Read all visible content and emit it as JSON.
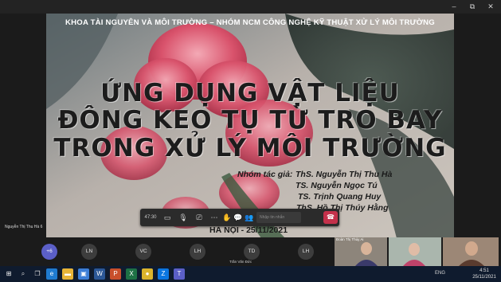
{
  "window": {
    "title": "",
    "controls": {
      "minimize": "–",
      "maximize": "⧉",
      "close": "✕"
    }
  },
  "slide": {
    "header": "KHOA TÀI NGUYÊN VÀ MÔI TRƯỜNG – NHÓM NCM CÔNG NGHỆ KỸ THUẬT XỬ LÝ MÔI TRƯỜNG",
    "title_lines": [
      "ỨNG DỤNG VẬT LIỆU",
      "ĐÔNG KEO TỤ TỪ TRO BAY",
      "TRONG XỬ LÝ MÔI TRƯỜNG"
    ],
    "authors_label": "Nhóm tác giả:",
    "authors": [
      "ThS. Nguyễn Thị Thu Hà",
      "TS. Nguyễn Ngọc Tú",
      "TS. Trịnh Quang Huy",
      "ThS. Hồ Thị Thúy Hằng"
    ],
    "place_date": "HÀ NỘI - 25/11/2021"
  },
  "call_controls": {
    "timer": "47:30",
    "chat_placeholder": "Nhập tin nhắn",
    "icons": [
      "camera-icon",
      "microphone-off-icon",
      "share-screen-icon",
      "more-icon",
      "raise-hand-icon",
      "chat-icon",
      "participants-icon"
    ],
    "leave_icon": "hang-up-icon"
  },
  "presenter": {
    "name": "Nguyễn Thị Thu Hà 6"
  },
  "participants": {
    "overflow_count": "+6",
    "avatars": [
      {
        "initials": "LN",
        "name": ""
      },
      {
        "initials": "VC",
        "name": ""
      },
      {
        "initials": "LH",
        "name": ""
      },
      {
        "initials": "TD",
        "name": "Trần Văn Đức"
      },
      {
        "initials": "LH",
        "name": ""
      }
    ],
    "videos": [
      {
        "name": "Đoàn Thị Thúy Ai"
      },
      {
        "name": ""
      },
      {
        "name": ""
      }
    ]
  },
  "taskbar": {
    "apps": [
      "start-icon",
      "search-icon",
      "task-view-icon",
      "edge-icon",
      "file-explorer-icon",
      "store-icon",
      "word-icon",
      "powerpoint-icon",
      "excel-icon",
      "chrome-icon",
      "zalo-icon",
      "teams-icon"
    ],
    "tray_language": "ENG",
    "time": "4:51",
    "date": "25/11/2021"
  }
}
